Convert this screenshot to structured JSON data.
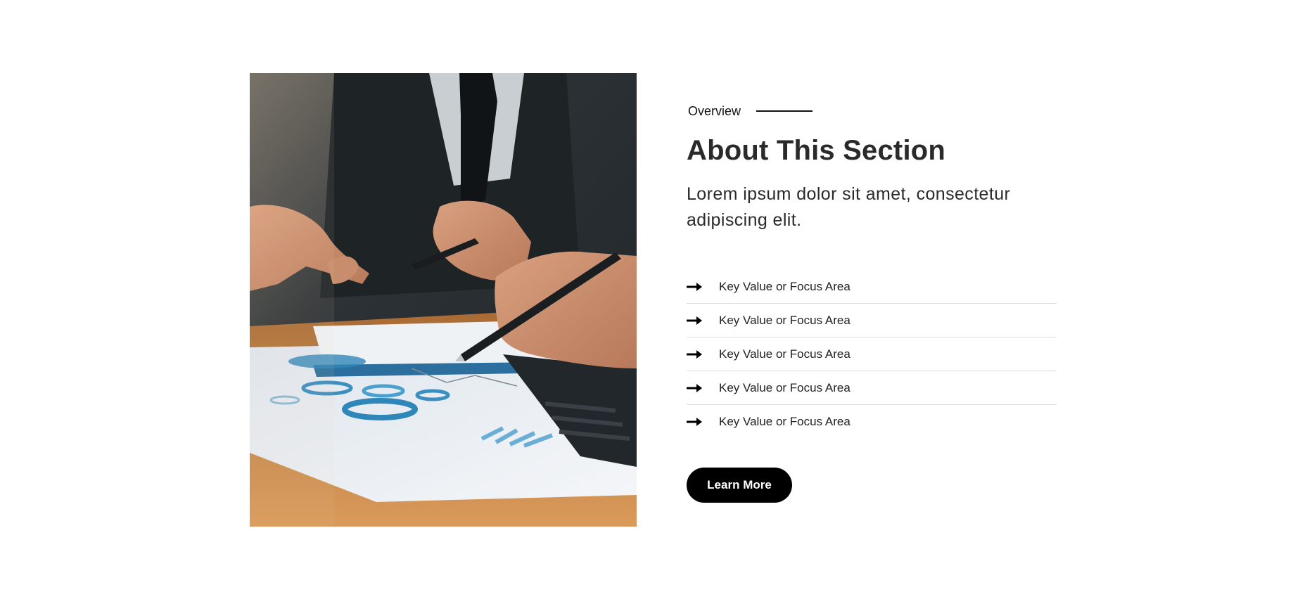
{
  "image": {
    "alt_icon": "business-meeting-photo",
    "colors": {
      "background_dark": "#2b3136",
      "table_wood": "#c98a4b",
      "paper": "#e8edf2",
      "chart_blue": "#2f86b8"
    }
  },
  "content": {
    "eyebrow": "Overview",
    "title": "About This Section",
    "lead": "Lorem ipsum dolor sit amet, consectetur adipiscing elit.",
    "list_icon": "arrow-right-icon",
    "list": [
      {
        "label": "Key Value or Focus Area"
      },
      {
        "label": "Key Value or Focus Area"
      },
      {
        "label": "Key Value or Focus Area"
      },
      {
        "label": "Key Value or Focus Area"
      },
      {
        "label": "Key Value or Focus Area"
      }
    ],
    "button_label": "Learn More",
    "accent_color": "#000000"
  }
}
